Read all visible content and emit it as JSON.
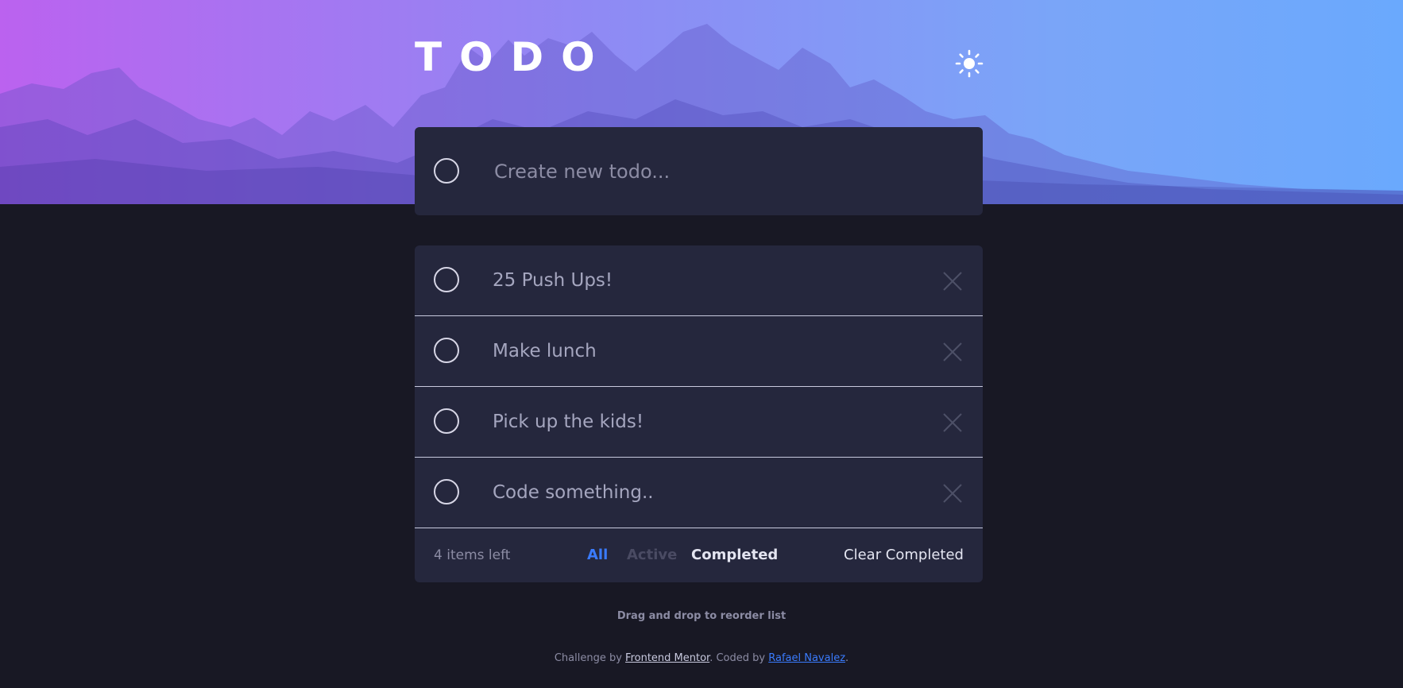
{
  "header": {
    "title": "TODO",
    "theme_icon": "sun-icon"
  },
  "create": {
    "placeholder": "Create new todo...",
    "value": ""
  },
  "todos": [
    {
      "text": "25 Push Ups!",
      "completed": false
    },
    {
      "text": "Make lunch",
      "completed": false
    },
    {
      "text": "Pick up the kids!",
      "completed": false
    },
    {
      "text": "Code something..",
      "completed": false
    }
  ],
  "footer": {
    "items_left": "4 items left",
    "filters": {
      "all": "All",
      "active": "Active",
      "completed": "Completed"
    },
    "selected_filter": "All",
    "clear_completed": "Clear Completed"
  },
  "hint": "Drag and drop to reorder list",
  "attribution": {
    "prefix": "Challenge by ",
    "challenge_link": "Frontend Mentor",
    "middle": ". Coded by ",
    "author_link": "Rafael Navalez",
    "suffix": "."
  },
  "colors": {
    "accent": "#3a7bfd",
    "card_bg": "#25273d",
    "page_bg": "#181824"
  }
}
